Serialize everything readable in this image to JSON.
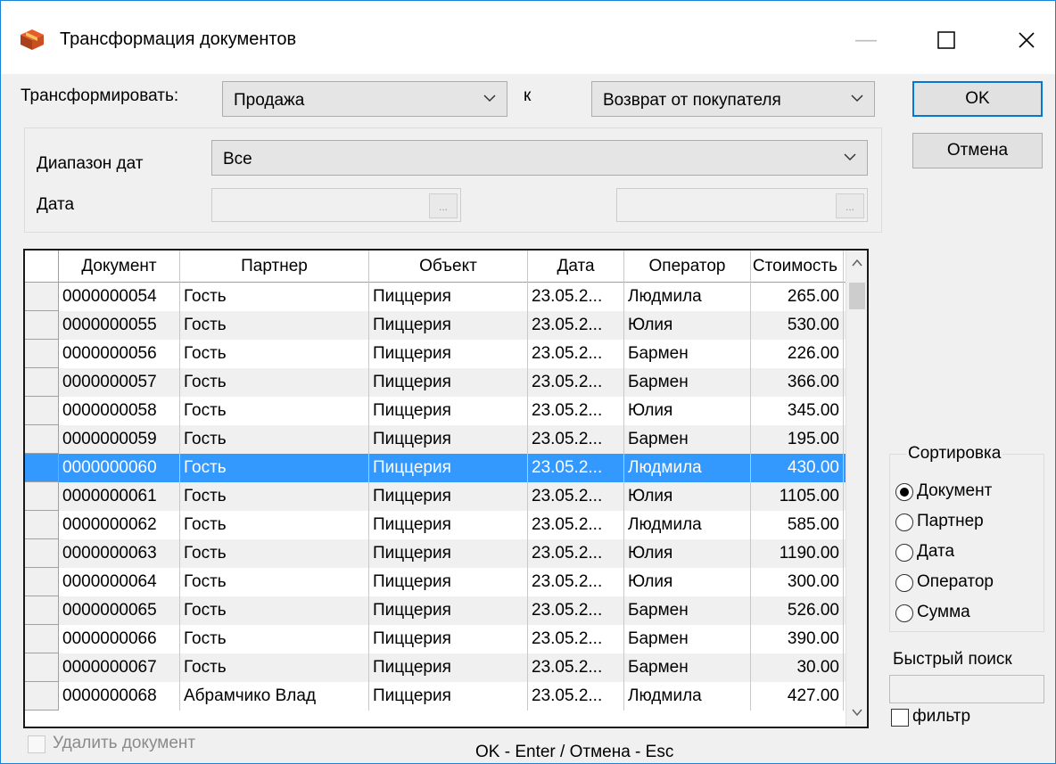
{
  "window": {
    "title": "Трансформация документов",
    "minimize_glyph": "—",
    "maximize_glyph": "☐",
    "close_glyph": "✕",
    "accent": "#1883d7"
  },
  "transform": {
    "label": "Трансформировать:",
    "from_value": "Продажа",
    "to_label": "к",
    "to_value": "Возврат от покупателя"
  },
  "buttons": {
    "ok": "OK",
    "cancel": "Отмена"
  },
  "date_range": {
    "label": "Диапазон дат",
    "value": "Все",
    "date_label": "Дата",
    "dots": "..."
  },
  "grid": {
    "columns": [
      "Документ",
      "Партнер",
      "Объект",
      "Дата",
      "Оператор",
      "Стоимость"
    ],
    "rows": [
      [
        "0000000054",
        "Гость",
        "Пиццерия",
        "23.05.2...",
        "Людмила",
        "265.00"
      ],
      [
        "0000000055",
        "Гость",
        "Пиццерия",
        "23.05.2...",
        "Юлия",
        "530.00"
      ],
      [
        "0000000056",
        "Гость",
        "Пиццерия",
        "23.05.2...",
        "Бармен",
        "226.00"
      ],
      [
        "0000000057",
        "Гость",
        "Пиццерия",
        "23.05.2...",
        "Бармен",
        "366.00"
      ],
      [
        "0000000058",
        "Гость",
        "Пиццерия",
        "23.05.2...",
        "Юлия",
        "345.00"
      ],
      [
        "0000000059",
        "Гость",
        "Пиццерия",
        "23.05.2...",
        "Бармен",
        "195.00"
      ],
      [
        "0000000060",
        "Гость",
        "Пиццерия",
        "23.05.2...",
        "Людмила",
        "430.00"
      ],
      [
        "0000000061",
        "Гость",
        "Пиццерия",
        "23.05.2...",
        "Юлия",
        "1105.00"
      ],
      [
        "0000000062",
        "Гость",
        "Пиццерия",
        "23.05.2...",
        "Людмила",
        "585.00"
      ],
      [
        "0000000063",
        "Гость",
        "Пиццерия",
        "23.05.2...",
        "Юлия",
        "1190.00"
      ],
      [
        "0000000064",
        "Гость",
        "Пиццерия",
        "23.05.2...",
        "Юлия",
        "300.00"
      ],
      [
        "0000000065",
        "Гость",
        "Пиццерия",
        "23.05.2...",
        "Бармен",
        "526.00"
      ],
      [
        "0000000066",
        "Гость",
        "Пиццерия",
        "23.05.2...",
        "Бармен",
        "390.00"
      ],
      [
        "0000000067",
        "Гость",
        "Пиццерия",
        "23.05.2...",
        "Бармен",
        "30.00"
      ],
      [
        "0000000068",
        "Абрамчико Влад",
        "Пиццерия",
        "23.05.2...",
        "Людмила",
        "427.00"
      ]
    ],
    "selected_row": 6,
    "selection_color": "#3399ff"
  },
  "sort": {
    "legend": "Сортировка",
    "options": [
      "Документ",
      "Партнер",
      "Дата",
      "Оператор",
      "Сумма"
    ],
    "selected": 0
  },
  "quick_search": {
    "label": "Быстрый поиск",
    "value": ""
  },
  "filter": {
    "label": "фильтр",
    "checked": false
  },
  "delete_doc": {
    "label": "Удалить документ",
    "checked": false
  },
  "hint": "OK - Enter / Отмена - Esc"
}
